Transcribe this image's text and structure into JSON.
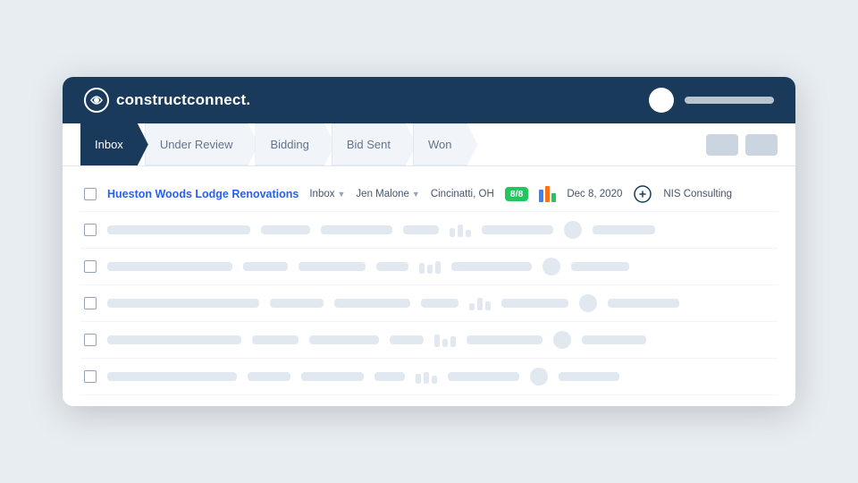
{
  "window": {
    "title": "ConstructConnect"
  },
  "topbar": {
    "logo_text_regular": "construct",
    "logo_text_bold": "connect.",
    "avatar_color": "#ffffff"
  },
  "tabs": [
    {
      "label": "Inbox",
      "active": true
    },
    {
      "label": "Under Review",
      "active": false
    },
    {
      "label": "Bidding",
      "active": false
    },
    {
      "label": "Bid Sent",
      "active": false
    },
    {
      "label": "Won",
      "active": false
    }
  ],
  "table": {
    "rows": [
      {
        "project_name": "Hueston Woods Lodge Renovations",
        "status_label": "Inbox",
        "person": "Jen Malone",
        "location": "Cincinatti, OH",
        "count": "8/8",
        "date": "Dec 8, 2020",
        "company": "NIS Consulting"
      }
    ],
    "skeleton_count": 5
  },
  "bars": {
    "colors": [
      "#3b82f6",
      "#f97316",
      "#22c55e"
    ]
  }
}
